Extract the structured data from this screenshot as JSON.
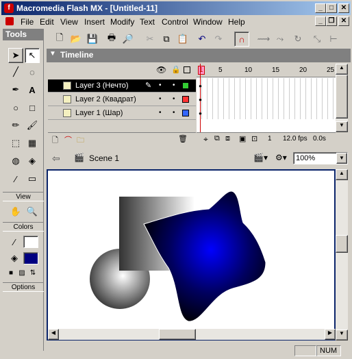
{
  "window": {
    "title": "Macromedia Flash MX - [Untitled-11]",
    "minimize": "_",
    "maximize": "□",
    "close": "✕"
  },
  "menu": {
    "items": [
      "File",
      "Edit",
      "View",
      "Insert",
      "Modify",
      "Text",
      "Control",
      "Window",
      "Help"
    ]
  },
  "tools_panel": {
    "title": "Tools",
    "view_label": "View",
    "colors_label": "Colors",
    "options_label": "Options",
    "stroke_color": "#ffffff",
    "fill_color": "#000080"
  },
  "timeline": {
    "title": "Timeline",
    "frame_ticks": [
      "1",
      "5",
      "10",
      "15",
      "20",
      "25"
    ],
    "current_frame": "1",
    "frame_rate": "12.0 fps",
    "time": "0.0s",
    "layers": [
      {
        "name": "Layer 3 (Нечто)",
        "selected": true,
        "color": "#33cc33"
      },
      {
        "name": "Layer 2 (Квадрат)",
        "selected": false,
        "color": "#ff3333"
      },
      {
        "name": "Layer 1 (Шар)",
        "selected": false,
        "color": "#3366ff"
      }
    ]
  },
  "stage_bar": {
    "scene": "Scene 1",
    "zoom": "100%"
  },
  "status": {
    "num": "NUM"
  }
}
